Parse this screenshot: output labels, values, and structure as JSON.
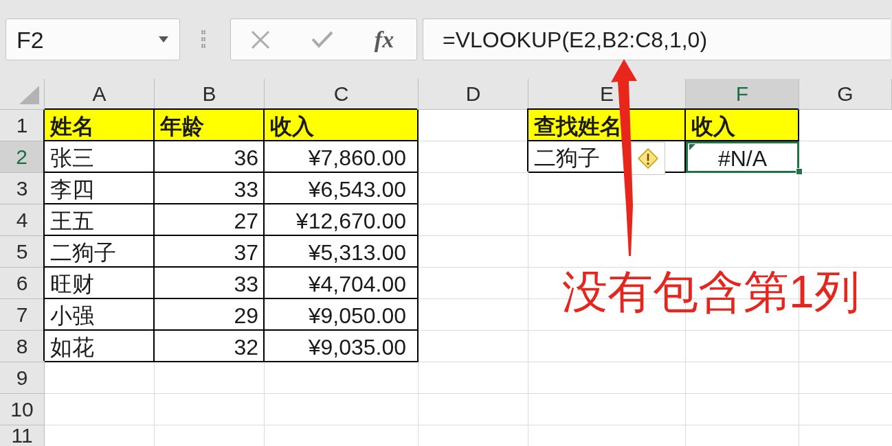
{
  "name_box": {
    "value": "F2"
  },
  "formula_buttons": [
    {
      "kind": "cancel",
      "disabled": true
    },
    {
      "kind": "enter",
      "disabled": true
    },
    {
      "kind": "function",
      "label": "fx",
      "disabled": false
    }
  ],
  "formula_bar": {
    "value": "=VLOOKUP(E2,B2:C8,1,0)"
  },
  "sheet": {
    "columns": [
      {
        "label": "A",
        "selected": false
      },
      {
        "label": "B",
        "selected": false
      },
      {
        "label": "C",
        "selected": false
      },
      {
        "label": "D",
        "selected": false
      },
      {
        "label": "E",
        "selected": false
      },
      {
        "label": "F",
        "selected": true
      },
      {
        "label": "G",
        "selected": false
      }
    ],
    "rows": [
      {
        "label": "1",
        "selected": false
      },
      {
        "label": "2",
        "selected": true
      },
      {
        "label": "3",
        "selected": false
      },
      {
        "label": "4",
        "selected": false
      },
      {
        "label": "5",
        "selected": false
      },
      {
        "label": "6",
        "selected": false
      },
      {
        "label": "7",
        "selected": false
      },
      {
        "label": "8",
        "selected": false
      },
      {
        "label": "9",
        "selected": false
      },
      {
        "label": "10",
        "selected": false
      },
      {
        "label": "11",
        "selected": false
      }
    ],
    "tables": [
      {
        "rows": [
          [
            {
              "text": "姓名",
              "kind": "heading",
              "selected": false
            },
            {
              "text": "年龄",
              "kind": "heading",
              "selected": false
            },
            {
              "text": "收入",
              "kind": "heading",
              "selected": false
            }
          ],
          [
            {
              "text": "张三",
              "kind": "text",
              "selected": false
            },
            {
              "text": "36",
              "kind": "number",
              "selected": false
            },
            {
              "text": "¥7,860.00",
              "kind": "currency",
              "selected": false
            }
          ],
          [
            {
              "text": "李四",
              "kind": "text",
              "selected": false
            },
            {
              "text": "33",
              "kind": "number",
              "selected": false
            },
            {
              "text": "¥6,543.00",
              "kind": "currency",
              "selected": false
            }
          ],
          [
            {
              "text": "王五",
              "kind": "text",
              "selected": false
            },
            {
              "text": "27",
              "kind": "number",
              "selected": false
            },
            {
              "text": "¥12,670.00",
              "kind": "currency",
              "selected": false
            }
          ],
          [
            {
              "text": "二狗子",
              "kind": "text",
              "selected": false
            },
            {
              "text": "37",
              "kind": "number",
              "selected": false
            },
            {
              "text": "¥5,313.00",
              "kind": "currency",
              "selected": false
            }
          ],
          [
            {
              "text": "旺财",
              "kind": "text",
              "selected": false
            },
            {
              "text": "33",
              "kind": "number",
              "selected": false
            },
            {
              "text": "¥4,704.00",
              "kind": "currency",
              "selected": false
            }
          ],
          [
            {
              "text": "小强",
              "kind": "text",
              "selected": false
            },
            {
              "text": "29",
              "kind": "number",
              "selected": false
            },
            {
              "text": "¥9,050.00",
              "kind": "currency",
              "selected": false
            }
          ],
          [
            {
              "text": "如花",
              "kind": "text",
              "selected": false
            },
            {
              "text": "32",
              "kind": "number",
              "selected": false
            },
            {
              "text": "¥9,035.00",
              "kind": "currency",
              "selected": false
            }
          ]
        ]
      },
      {
        "rows": [
          [
            {
              "text": "查找姓名",
              "kind": "heading",
              "selected": false
            },
            {
              "text": "收入",
              "kind": "heading",
              "selected": false
            }
          ],
          [
            {
              "text": "二狗子",
              "kind": "text",
              "selected": false
            },
            {
              "text": "#N/A",
              "kind": "error",
              "selected": true
            }
          ]
        ]
      }
    ]
  },
  "annotation": {
    "text": "没有包含第1列"
  }
}
